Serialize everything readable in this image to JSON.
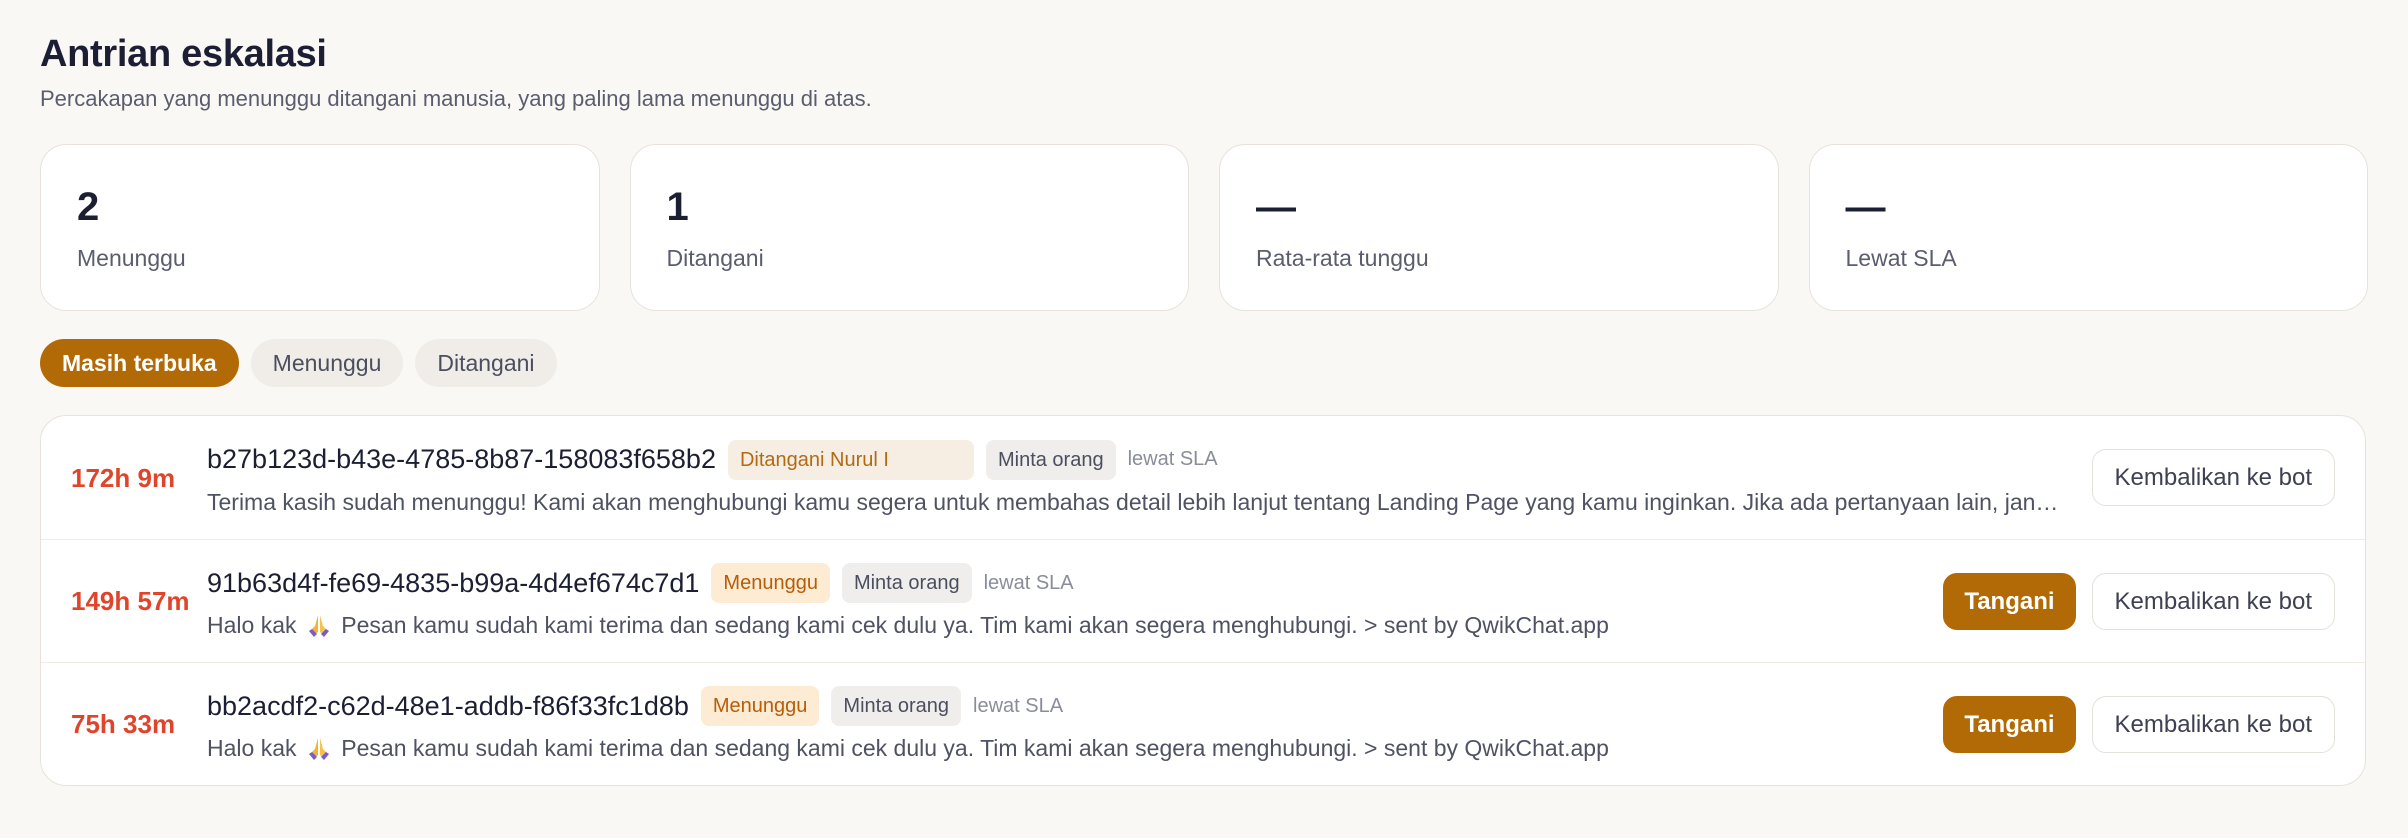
{
  "header": {
    "title": "Antrian eskalasi",
    "subtitle": "Percakapan yang menunggu ditangani manusia, yang paling lama menunggu di atas."
  },
  "stats": [
    {
      "value": "2",
      "label": "Menunggu"
    },
    {
      "value": "1",
      "label": "Ditangani"
    },
    {
      "value": "—",
      "label": "Rata-rata tunggu"
    },
    {
      "value": "—",
      "label": "Lewat SLA"
    }
  ],
  "filters": [
    {
      "label": "Masih terbuka",
      "active": true
    },
    {
      "label": "Menunggu",
      "active": false
    },
    {
      "label": "Ditangani",
      "active": false
    }
  ],
  "rows": [
    {
      "wait": "172h 9m",
      "id": "b27b123d-b43e-4785-8b87-158083f658b2",
      "status": "Ditangani Nurul I",
      "request": "Minta orang",
      "sla": "lewat SLA",
      "preview": "Terima kasih sudah menunggu! Kami akan menghubungi kamu segera untuk membahas detail lebih lanjut tentang Landing Page yang kamu inginkan. Jika ada pertanyaan lain, jangan ragu untuk bertanya ya.",
      "handle_label": "",
      "return_label": "Kembalikan ke bot"
    },
    {
      "wait": "149h 57m",
      "id": "91b63d4f-fe69-4835-b99a-4d4ef674c7d1",
      "status": "Menunggu",
      "request": "Minta orang",
      "sla": "lewat SLA",
      "preview_pre": "Halo kak",
      "preview_post": "Pesan kamu sudah kami terima dan sedang kami cek dulu ya. Tim kami akan segera menghubungi. > sent by QwikChat.app",
      "handle_label": "Tangani",
      "return_label": "Kembalikan ke bot"
    },
    {
      "wait": "75h 33m",
      "id": "bb2acdf2-c62d-48e1-addb-f86f33fc1d8b",
      "status": "Menunggu",
      "request": "Minta orang",
      "sla": "lewat SLA",
      "preview_pre": "Halo kak",
      "preview_post": "Pesan kamu sudah kami terima dan sedang kami cek dulu ya. Tim kami akan segera menghubungi. > sent by QwikChat.app",
      "handle_label": "Tangani",
      "return_label": "Kembalikan ke bot"
    }
  ],
  "colors": {
    "accent": "#b26a06",
    "wait_text": "#e0452b",
    "background": "#faf8f5"
  },
  "icons": {
    "preview_emoji": "folded-hands-icon"
  }
}
